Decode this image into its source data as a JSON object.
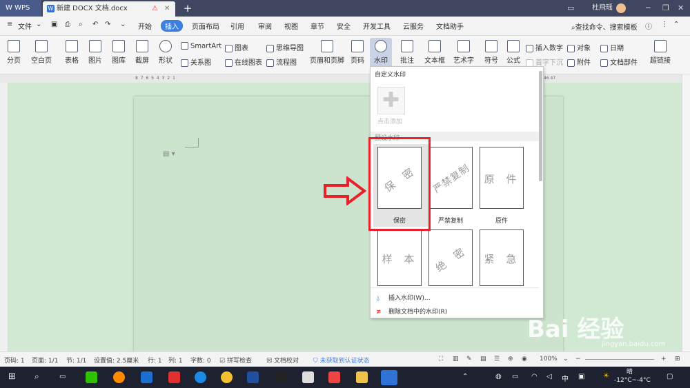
{
  "titlebar": {
    "app_label": "WPS",
    "doc_tab": "新建 DOCX 文档.docx",
    "new_tab": "+",
    "user": "杜飛瑶"
  },
  "menubar": {
    "file": "文件",
    "items": [
      "开始",
      "插入",
      "页面布局",
      "引用",
      "审阅",
      "视图",
      "章节",
      "安全",
      "开发工具",
      "云服务",
      "文档助手"
    ],
    "active": "插入",
    "search": "查找命令、搜索模板"
  },
  "ribbon": {
    "page_break": "分页",
    "blank_page": "空白页",
    "table": "表格",
    "picture": "图片",
    "gallery": "图库",
    "screenshot": "截屏",
    "shape": "形状",
    "smartart": "SmartArt",
    "relation": "关系图",
    "chart": "图表",
    "online_chart": "在线图表",
    "mindmap": "思维导图",
    "flowchart": "流程图",
    "header_footer": "页眉和页脚",
    "page_number": "页码",
    "watermark": "水印",
    "comment": "批注",
    "textbox": "文本框",
    "wordart": "艺术字",
    "symbol": "符号",
    "formula": "公式",
    "insert_number": "插入数字",
    "first_drop": "首字下沉",
    "object": "对象",
    "attachment": "附件",
    "date": "日期",
    "doc_parts": "文档部件",
    "hyperlink": "超链接"
  },
  "ruler": {
    "left_marks": "8 7 6 5 4 3 2 1",
    "right_mark": "46 47"
  },
  "dropdown": {
    "custom_section": "自定义水印",
    "add_label": "点击添加",
    "preset_section": "预设水印",
    "presets": [
      {
        "text": "保 密",
        "label": "保密"
      },
      {
        "text": "严禁复制",
        "label": "严禁复制"
      },
      {
        "text": "原 件",
        "label": "原件"
      },
      {
        "text": "样 本",
        "label": ""
      },
      {
        "text": "绝 密",
        "label": ""
      },
      {
        "text": "紧 急",
        "label": ""
      }
    ],
    "insert_watermark": "插入水印(W)...",
    "remove_watermark": "删除文档中的水印(R)"
  },
  "statusbar": {
    "page_code": "页码: 1",
    "pages": "页面: 1/1",
    "section": "节: 1/1",
    "setting": "设置值: 2.5厘米",
    "row": "行: 1",
    "col": "列: 1",
    "words": "字数: 0",
    "spell": "拼写检查",
    "proofread": "文档校对",
    "auth": "未获取到认证状态",
    "zoom": "100%"
  },
  "taskbar": {
    "ime": "中",
    "weather_label": "晴",
    "temperature": "-12°C~-4°C"
  },
  "overlay": {
    "brand": "Bai 经验",
    "url": "jingyan.baidu.com"
  },
  "colors": {
    "accent": "#3c7fe0",
    "highlight": "#e8202a",
    "doc_bg": "#d1e8d2"
  }
}
